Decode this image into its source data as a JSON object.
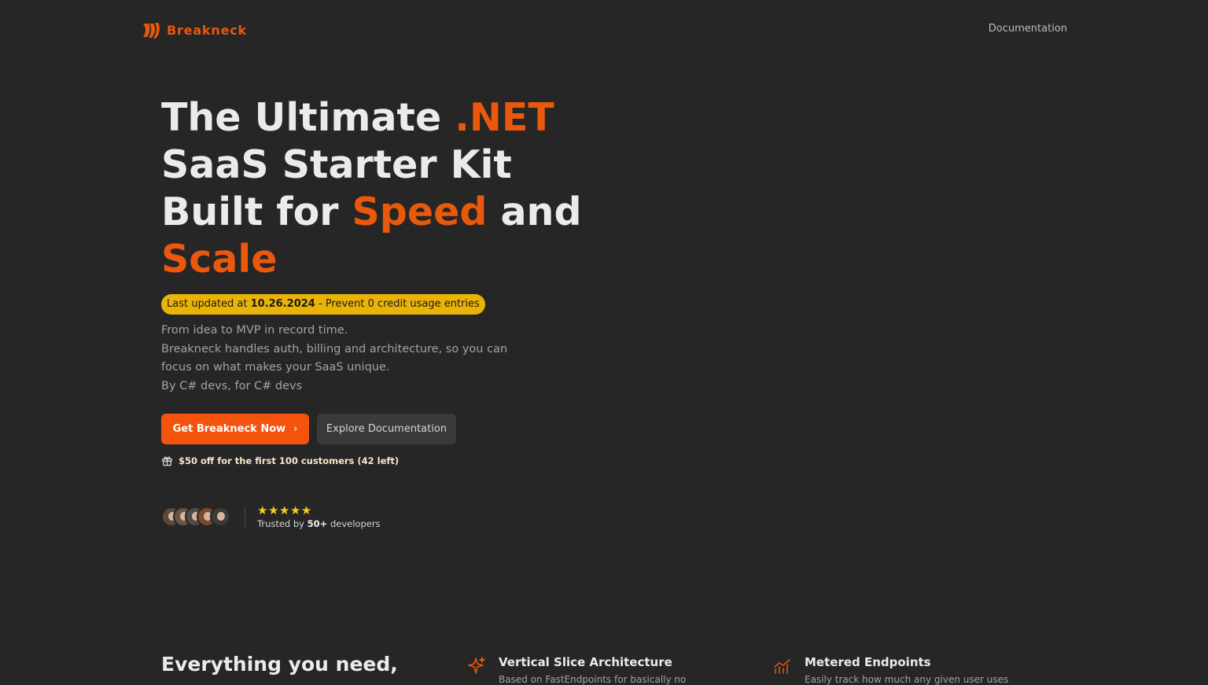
{
  "header": {
    "brand": "Breakneck",
    "nav_documentation": "Documentation"
  },
  "hero": {
    "title_part1": "The Ultimate ",
    "title_highlight1": ".NET",
    "title_part2": "SaaS Starter Kit",
    "title_part3": "Built for ",
    "title_highlight2": "Speed",
    "title_part4": " and",
    "title_highlight3": "Scale",
    "badge_prefix": "Last updated at ",
    "badge_date": "10.26.2024",
    "badge_suffix": " - Prevent 0 credit usage entries",
    "desc_line1": "From idea to MVP in record time.",
    "desc_line2": "Breakneck handles auth, billing and architecture, so you can focus on what makes your SaaS unique.",
    "desc_line3": "By C# devs, for C# devs",
    "cta_primary": "Get Breakneck Now",
    "cta_primary_icon": "chevron-right-icon",
    "cta_secondary": "Explore Documentation",
    "offer_icon": "gift-icon",
    "offer": "$50 off for the first 100 customers (42 left)",
    "rating": "★★★★★",
    "trusted_prefix": "Trusted by ",
    "trusted_count": "50+",
    "trusted_suffix": " developers"
  },
  "features": {
    "heading": "Everything you need,",
    "items": [
      {
        "icon": "sparkle-icon",
        "title": "Vertical Slice Architecture",
        "desc": "Based on FastEndpoints for basically no"
      },
      {
        "icon": "chart-line-icon",
        "title": "Metered Endpoints",
        "desc": "Easily track how much any given user uses"
      }
    ]
  },
  "colors": {
    "background": "#262626",
    "accent": "#ea580c",
    "button_primary": "#f4530d",
    "badge": "#eab308",
    "stars": "#facc15"
  }
}
